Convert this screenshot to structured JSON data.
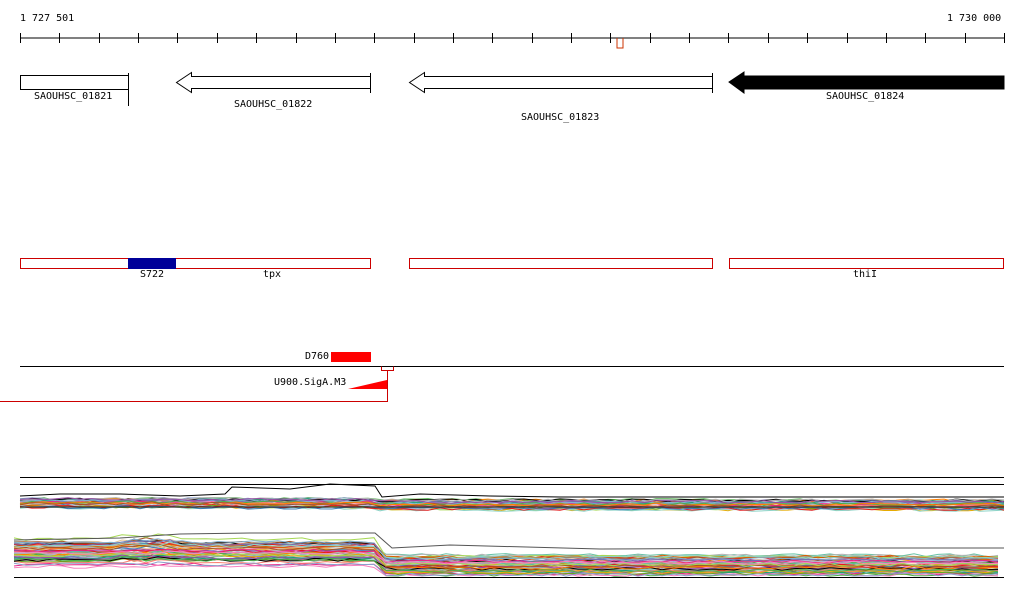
{
  "ruler": {
    "start_label": "1 727 501",
    "end_label": "1 730 000"
  },
  "genes": [
    {
      "locus": "SAOUHSC_01821",
      "strand": "+",
      "filled": false
    },
    {
      "locus": "SAOUHSC_01822",
      "strand": "-",
      "filled": false
    },
    {
      "locus": "SAOUHSC_01823",
      "strand": "-",
      "filled": false
    },
    {
      "locus": "SAOUHSC_01824",
      "strand": "-",
      "filled": true
    }
  ],
  "annotations": {
    "features": [
      {
        "name": "",
        "color": "#ffffff",
        "border": "#cc0000"
      },
      {
        "name": "S722",
        "color": "#000099",
        "border": "#000099"
      },
      {
        "name": "tpx",
        "color": "#ffffff",
        "border": "#cc0000"
      },
      {
        "name": "",
        "color": "#ffffff",
        "border": "#cc0000"
      },
      {
        "name": "thiI",
        "color": "#ffffff",
        "border": "#cc0000"
      }
    ]
  },
  "regulatory": {
    "d760_label": "D760",
    "d760_color": "#ff0000",
    "promoter_label": "U900.SigA.M3",
    "promoter_color": "#ff0000"
  },
  "colors": {
    "gene_fill": "#000000",
    "feature_border": "#cc0000",
    "tick_marker": "#cc3300"
  }
}
